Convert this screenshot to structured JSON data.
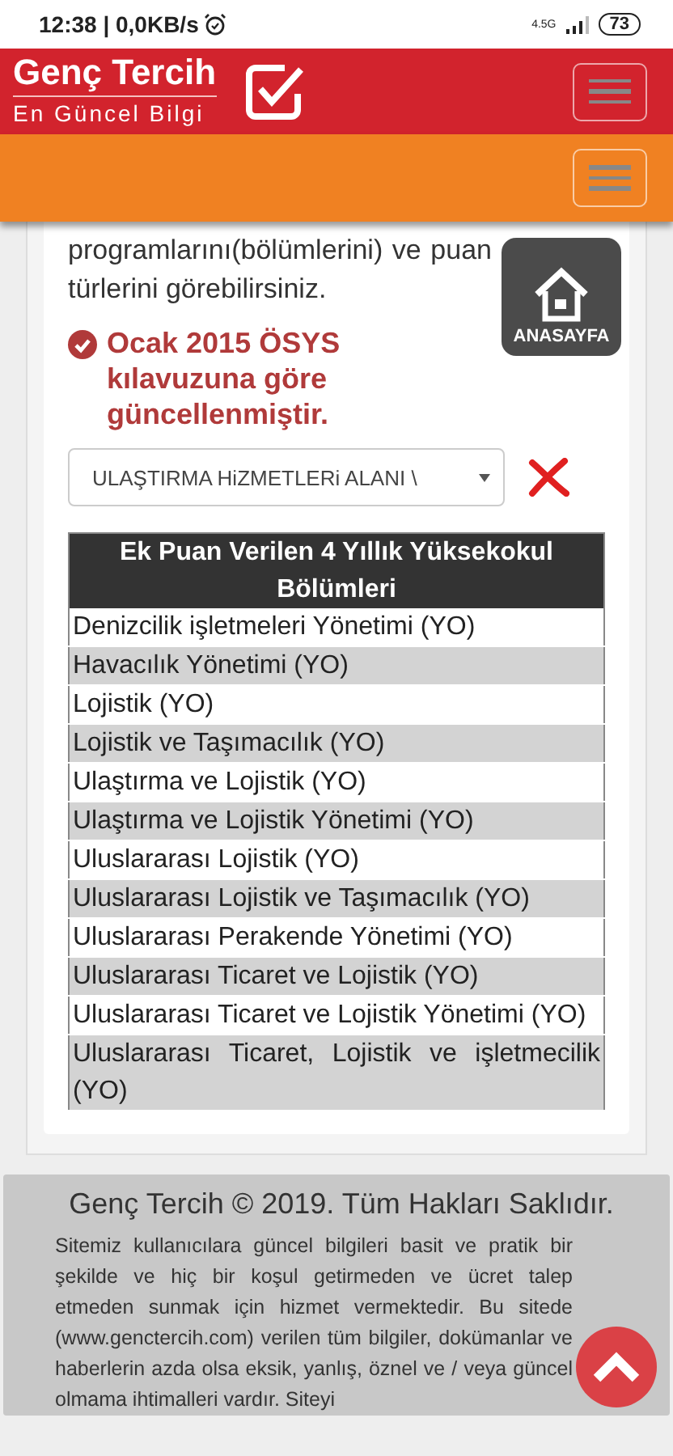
{
  "status_bar": {
    "time": "12:38 | 0,0KB/s",
    "network": "4.5G",
    "battery": "73"
  },
  "header": {
    "logo_title": "Genç Tercih",
    "logo_subtitle": "En Güncel Bilgi"
  },
  "home_button": {
    "label": "ANASAYFA"
  },
  "intro": "programlarını(bölümlerini) ve puan türlerini görebilirsiniz.",
  "notice": "Ocak 2015 ÖSYS kılavuzuna göre güncellenmiştir.",
  "select": {
    "value": "ULAŞTIRMA HiZMETLERi ALANI \\"
  },
  "table": {
    "title": "Ek Puan Verilen 4 Yıllık Yüksekokul Bölümleri",
    "rows": [
      "Denizcilik işletmeleri Yönetimi (YO)",
      "Havacılık Yönetimi (YO)",
      "Lojistik (YO)",
      "Lojistik ve Taşımacılık (YO)",
      "Ulaştırma ve Lojistik (YO)",
      "Ulaştırma ve Lojistik Yönetimi (YO)",
      "Uluslararası Lojistik (YO)",
      "Uluslararası Lojistik ve Taşımacılık (YO)",
      "Uluslararası Perakende Yönetimi (YO)",
      "Uluslararası Ticaret ve Lojistik (YO)",
      "Uluslararası Ticaret ve Lojistik Yönetimi (YO)",
      "Uluslararası Ticaret, Lojistik ve işletmecilik (YO)"
    ]
  },
  "footer": {
    "copyright": "Genç Tercih © 2019. Tüm Hakları Saklıdır.",
    "text": "Sitemiz kullanıcılara güncel bilgileri basit ve pratik bir şekilde ve hiç bir koşul getirmeden ve ücret talep etmeden sunmak için hizmet vermektedir. Bu sitede (www.genctercih.com) verilen tüm bilgiler, dokümanlar ve haberlerin azda olsa eksik, yanlış, öznel ve / veya güncel olmama ihtimalleri vardır. Siteyi"
  }
}
